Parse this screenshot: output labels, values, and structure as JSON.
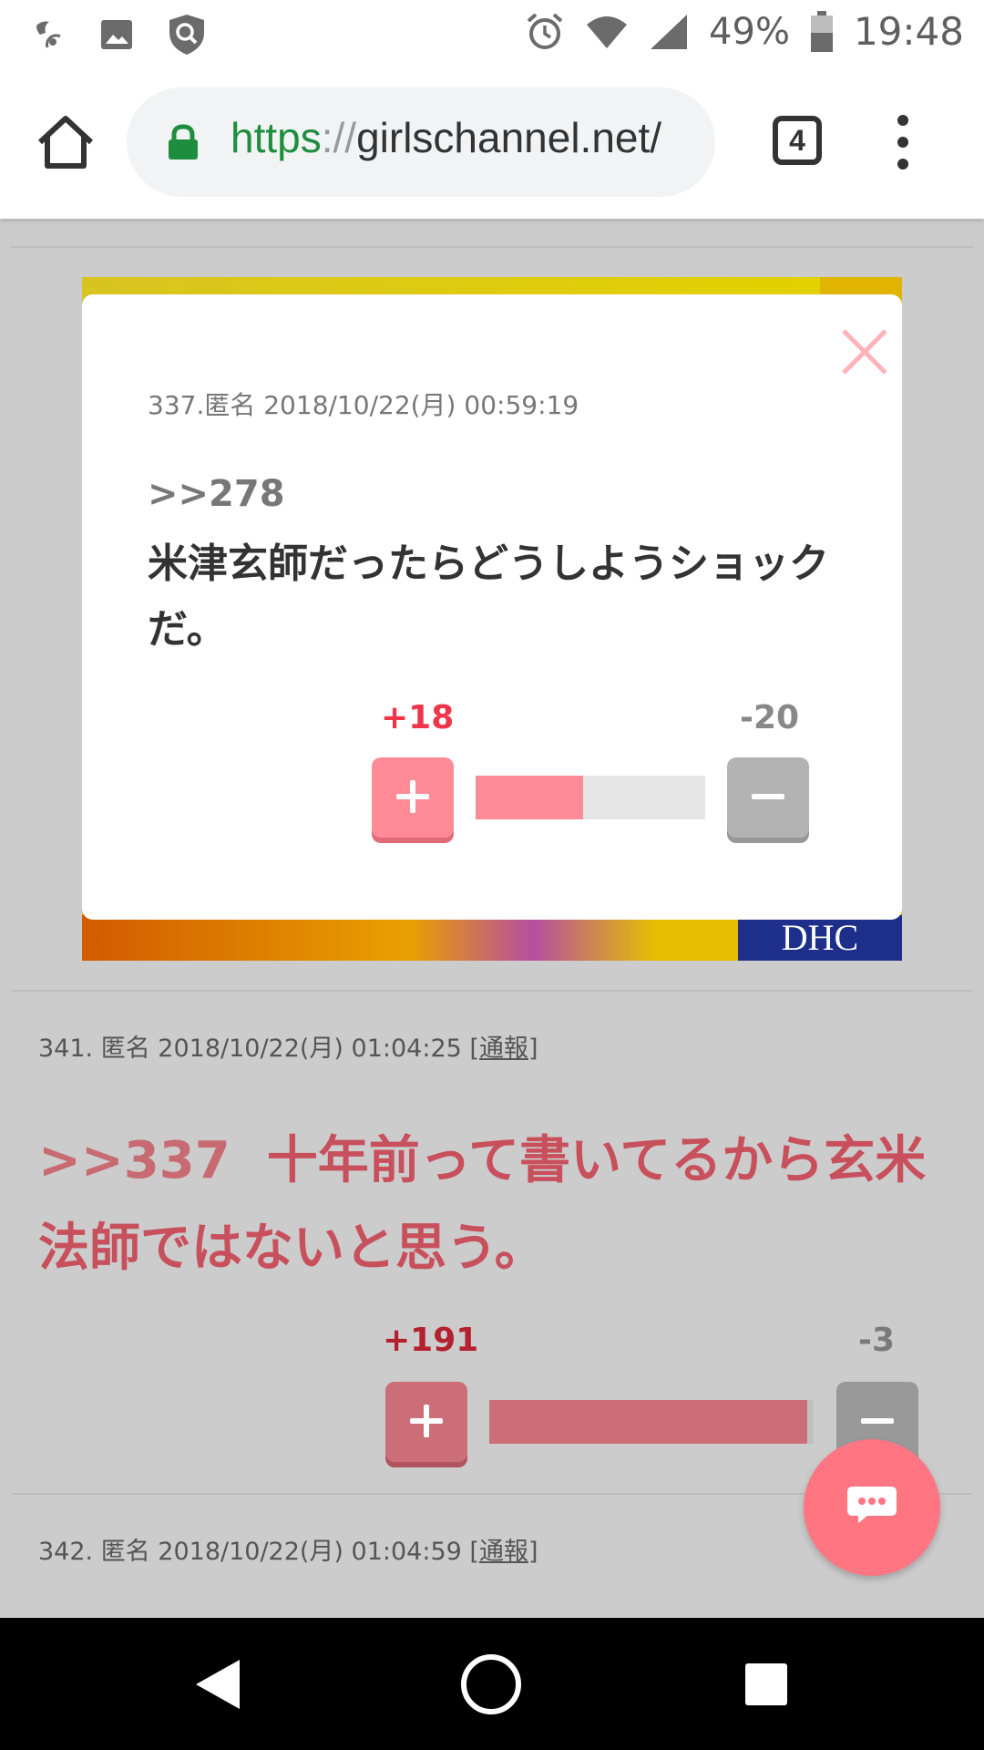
{
  "status_bar": {
    "battery": "49%",
    "time": "19:48"
  },
  "browser": {
    "url_scheme": "https",
    "url_separator": "://",
    "url_host": "girlschannel.net/",
    "tab_count": "4"
  },
  "modal": {
    "meta": "337.匿名 2018/10/22(月) 00:59:19",
    "anchor": ">>278",
    "body": "米津玄師だったらどうしようショックだ。",
    "plus_count": "+18",
    "minus_count": "-20",
    "plus_ratio": 0.47
  },
  "comments": [
    {
      "meta_prefix": "341. 匿名 2018/10/22(月) 01:04:25 [",
      "report_label": "通報",
      "meta_suffix": "]",
      "anchor": ">>337",
      "body": "十年前って書いてるから玄米法師ではないと思う。",
      "plus_count": "+191",
      "minus_count": "-3",
      "plus_ratio": 0.98
    },
    {
      "meta_prefix": "342. 匿名 2018/10/22(月) 01:04:59 [",
      "report_label": "通報",
      "meta_suffix": "]"
    }
  ],
  "colors": {
    "plus": "#ff8b96",
    "plus_dim": "#cc6e77",
    "minus": "#b3b3b3",
    "minus_dim": "#999999",
    "fab": "#ff7581",
    "url_scheme": "#1e8e3e"
  },
  "icons": {
    "status_left": [
      "wifi-calling-icon",
      "image-icon",
      "shield-search-icon"
    ],
    "status_right": [
      "alarm-icon",
      "wifi-icon",
      "signal-icon",
      "battery-icon"
    ],
    "toolbar": [
      "home-icon",
      "lock-icon",
      "tab-switcher-icon",
      "more-vert-icon"
    ],
    "fab": "chat-bubble-icon",
    "nav": [
      "back-icon",
      "home-circle-icon",
      "recents-icon"
    ]
  }
}
